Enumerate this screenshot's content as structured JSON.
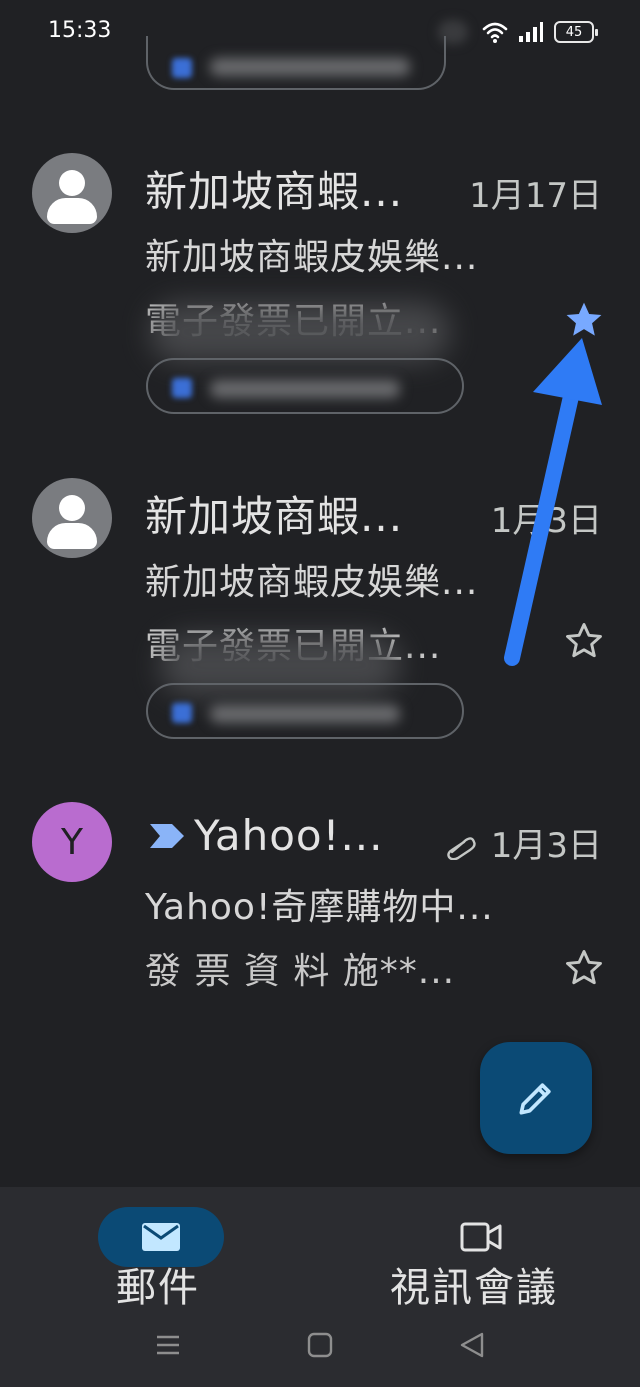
{
  "status_bar": {
    "time": "15:33",
    "battery": "45"
  },
  "emails": [
    {
      "sender": "新加坡商蝦...",
      "date": "1月17日",
      "subject": "新加坡商蝦皮娛樂...",
      "snippet": "電子發票已開立...",
      "starred": true,
      "star_color": "#78a9ff"
    },
    {
      "sender": "新加坡商蝦...",
      "date": "1月3日",
      "subject": "新加坡商蝦皮娛樂...",
      "snippet": "電子發票已開立...",
      "starred": false
    },
    {
      "avatar_letter": "Y",
      "sender": "Yahoo!...",
      "date": "1月3日",
      "subject": "Yahoo!奇摩購物中...",
      "snippet": "發 票 資 料 施**...",
      "starred": false,
      "has_attachment": true,
      "important_marker_color": "#8ab4f8"
    }
  ],
  "compose": {
    "icon": "pencil-icon"
  },
  "bottom_nav": {
    "mail": {
      "label": "郵件",
      "icon": "mail-icon",
      "active": true
    },
    "meet": {
      "label": "視訊會議",
      "icon": "video-icon"
    }
  },
  "system_nav": {
    "icons": [
      "menu-icon",
      "home-icon",
      "back-icon"
    ]
  },
  "colors": {
    "background": "#202124",
    "accent": "#0b4a75",
    "annotation_arrow": "#2f7bf5",
    "avatar_letter_bg": "#b96ccf"
  }
}
